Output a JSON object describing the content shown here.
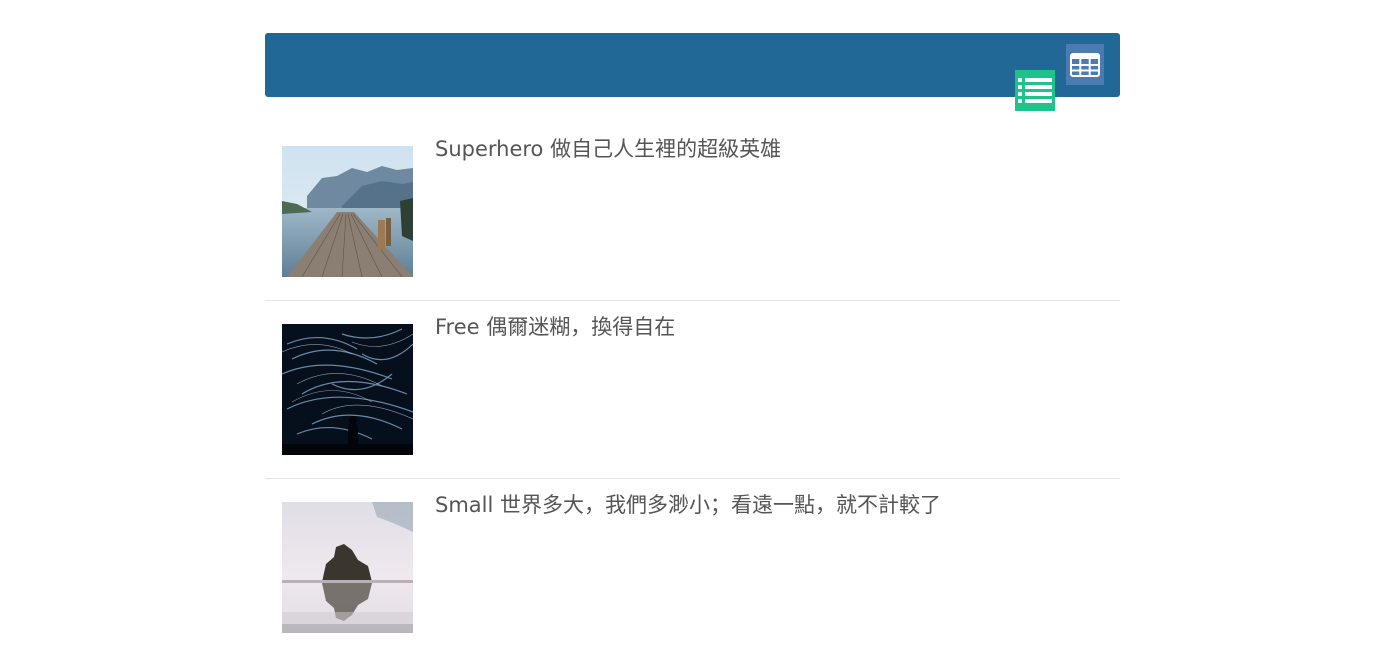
{
  "toolbar": {
    "list_view_icon": "list-icon",
    "grid_view_icon": "grid-icon",
    "list_view_color": "#1ec28b",
    "grid_view_color": "#4a7cb1",
    "bar_color": "#216896"
  },
  "items": [
    {
      "title": "Superhero 做自己人生裡的超級英雄",
      "image": "lake-pier-mountains"
    },
    {
      "title": "Free 偶爾迷糊，換得自在",
      "image": "star-trails-night-sky"
    },
    {
      "title": "Small 世界多大，我們多渺小；看遠一點，就不計較了",
      "image": "rock-island-reflection"
    }
  ]
}
